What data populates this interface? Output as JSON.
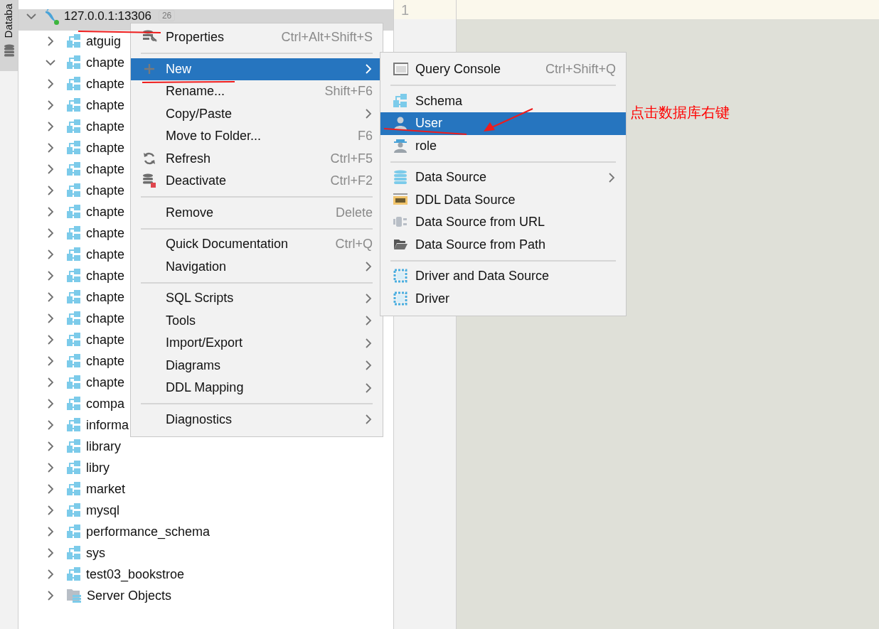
{
  "tool_strip": {
    "label": "Databa"
  },
  "tree": [
    {
      "label": "127.0.0.1:13306",
      "badge": "26",
      "kind": "connection",
      "expanded": true,
      "selected": true,
      "children": [
        {
          "label": "atguig",
          "kind": "schema",
          "expanded": false,
          "selected": false
        },
        {
          "label": "chapte",
          "kind": "schema",
          "expanded": true,
          "selected": false
        },
        {
          "label": "chapte",
          "kind": "schema",
          "expanded": false,
          "selected": false
        },
        {
          "label": "chapte",
          "kind": "schema",
          "expanded": false,
          "selected": false
        },
        {
          "label": "chapte",
          "kind": "schema",
          "expanded": false,
          "selected": false
        },
        {
          "label": "chapte",
          "kind": "schema",
          "expanded": false,
          "selected": false
        },
        {
          "label": "chapte",
          "kind": "schema",
          "expanded": false,
          "selected": false
        },
        {
          "label": "chapte",
          "kind": "schema",
          "expanded": false,
          "selected": false
        },
        {
          "label": "chapte",
          "kind": "schema",
          "expanded": false,
          "selected": false
        },
        {
          "label": "chapte",
          "kind": "schema",
          "expanded": false,
          "selected": false
        },
        {
          "label": "chapte",
          "kind": "schema",
          "expanded": false,
          "selected": false
        },
        {
          "label": "chapte",
          "kind": "schema",
          "expanded": false,
          "selected": false
        },
        {
          "label": "chapte",
          "kind": "schema",
          "expanded": false,
          "selected": false
        },
        {
          "label": "chapte",
          "kind": "schema",
          "expanded": false,
          "selected": false
        },
        {
          "label": "chapte",
          "kind": "schema",
          "expanded": false,
          "selected": false
        },
        {
          "label": "chapte",
          "kind": "schema",
          "expanded": false,
          "selected": false
        },
        {
          "label": "chapte",
          "kind": "schema",
          "expanded": false,
          "selected": false
        },
        {
          "label": "compa",
          "kind": "schema",
          "expanded": false,
          "selected": false
        },
        {
          "label": "informa",
          "kind": "schema",
          "expanded": false,
          "selected": false
        },
        {
          "label": "library",
          "kind": "schema",
          "expanded": false,
          "selected": false
        },
        {
          "label": "libry",
          "kind": "schema",
          "expanded": false,
          "selected": false
        },
        {
          "label": "market",
          "kind": "schema",
          "expanded": false,
          "selected": false
        },
        {
          "label": "mysql",
          "kind": "schema",
          "expanded": false,
          "selected": false
        },
        {
          "label": "performance_schema",
          "kind": "schema",
          "expanded": false,
          "selected": false
        },
        {
          "label": "sys",
          "kind": "schema",
          "expanded": false,
          "selected": false
        },
        {
          "label": "test03_bookstroe",
          "kind": "schema",
          "expanded": false,
          "selected": false
        },
        {
          "label": "Server Objects",
          "kind": "folder",
          "expanded": false,
          "selected": false
        }
      ]
    }
  ],
  "editor": {
    "line_numbers": [
      "1"
    ]
  },
  "context_menu": {
    "groups": [
      [
        {
          "label": "Properties",
          "shortcut": "Ctrl+Alt+Shift+S",
          "submenu": false,
          "selected": false
        }
      ],
      [
        {
          "label": "New",
          "submenu": true,
          "selected": true
        },
        {
          "label": "Rename...",
          "shortcut": "Shift+F6",
          "submenu": false,
          "selected": false
        },
        {
          "label": "Copy/Paste",
          "submenu": true,
          "selected": false
        },
        {
          "label": "Move to Folder...",
          "shortcut": "F6",
          "submenu": false,
          "selected": false
        },
        {
          "label": "Refresh",
          "shortcut": "Ctrl+F5",
          "submenu": false,
          "selected": false
        },
        {
          "label": "Deactivate",
          "shortcut": "Ctrl+F2",
          "submenu": false,
          "selected": false
        }
      ],
      [
        {
          "label": "Remove",
          "shortcut": "Delete",
          "submenu": false,
          "selected": false
        }
      ],
      [
        {
          "label": "Quick Documentation",
          "shortcut": "Ctrl+Q",
          "submenu": false,
          "selected": false
        },
        {
          "label": "Navigation",
          "submenu": true,
          "selected": false
        }
      ],
      [
        {
          "label": "SQL Scripts",
          "submenu": true,
          "selected": false
        },
        {
          "label": "Tools",
          "submenu": true,
          "selected": false
        },
        {
          "label": "Import/Export",
          "submenu": true,
          "selected": false
        },
        {
          "label": "Diagrams",
          "submenu": true,
          "selected": false
        },
        {
          "label": "DDL Mapping",
          "submenu": true,
          "selected": false
        }
      ],
      [
        {
          "label": "Diagnostics",
          "submenu": true,
          "selected": false
        }
      ]
    ]
  },
  "new_submenu": {
    "groups": [
      [
        {
          "label": "Query Console",
          "shortcut": "Ctrl+Shift+Q",
          "submenu": false,
          "selected": false
        }
      ],
      [
        {
          "label": "Schema",
          "submenu": false,
          "selected": false
        },
        {
          "label": "User",
          "submenu": false,
          "selected": true
        },
        {
          "label": "role",
          "submenu": false,
          "selected": false
        }
      ],
      [
        {
          "label": "Data Source",
          "submenu": true,
          "selected": false
        },
        {
          "label": "DDL Data Source",
          "submenu": false,
          "selected": false
        },
        {
          "label": "Data Source from URL",
          "submenu": false,
          "selected": false
        },
        {
          "label": "Data Source from Path",
          "submenu": false,
          "selected": false
        }
      ],
      [
        {
          "label": "Driver and Data Source",
          "submenu": false,
          "selected": false
        },
        {
          "label": "Driver",
          "submenu": false,
          "selected": false
        }
      ]
    ]
  },
  "annotation": {
    "text": "点击数据库右键"
  }
}
